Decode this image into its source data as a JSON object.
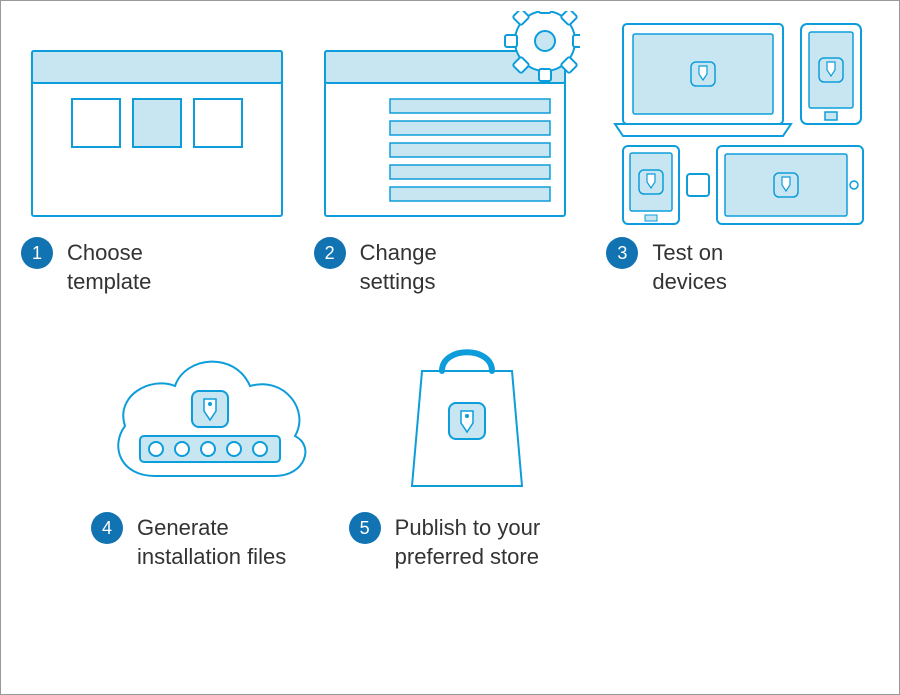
{
  "colors": {
    "stroke": "#0d9ddb",
    "fill_light": "#c8e6f2",
    "badge": "#1273b3"
  },
  "steps": [
    {
      "num": "1",
      "label": "Choose\ntemplate"
    },
    {
      "num": "2",
      "label": "Change\nsettings"
    },
    {
      "num": "3",
      "label": "Test on\ndevices"
    },
    {
      "num": "4",
      "label": "Generate\ninstallation files"
    },
    {
      "num": "5",
      "label": "Publish to your\npreferred store"
    }
  ]
}
